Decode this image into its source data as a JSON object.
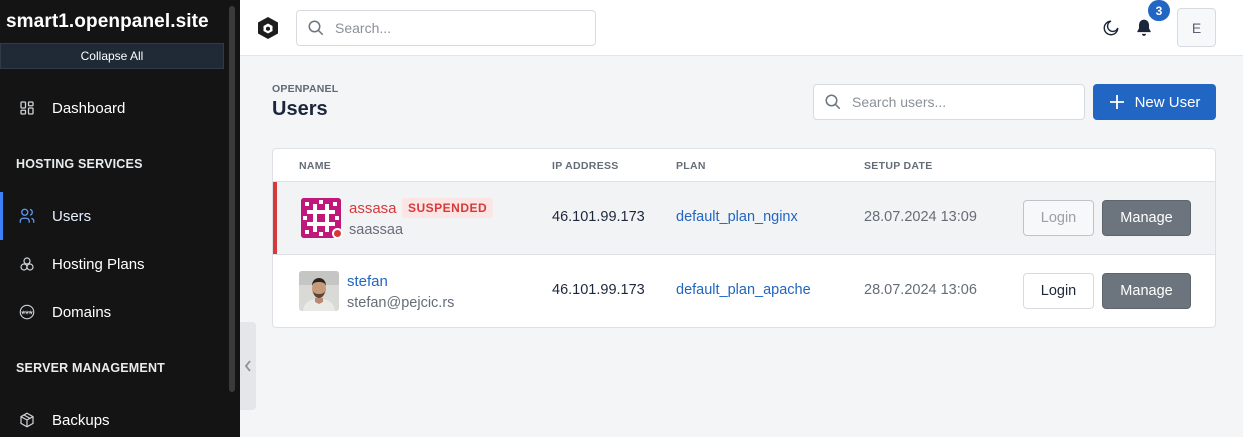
{
  "sidebar": {
    "site_title": "smart1.openpanel.site",
    "collapse_label": "Collapse All",
    "dashboard": "Dashboard",
    "section_hosting": "HOSTING SERVICES",
    "users": "Users",
    "hosting_plans": "Hosting Plans",
    "domains": "Domains",
    "section_server": "SERVER MANAGEMENT",
    "backups": "Backups"
  },
  "header": {
    "search_placeholder": "Search...",
    "notification_count": "3",
    "avatar_initial": "E"
  },
  "page": {
    "pretitle": "OPENPANEL",
    "title": "Users",
    "search_placeholder": "Search users...",
    "new_user_label": "New User"
  },
  "table": {
    "columns": [
      "NAME",
      "IP ADDRESS",
      "PLAN",
      "SETUP DATE"
    ],
    "rows": [
      {
        "username": "assasa",
        "status": "SUSPENDED",
        "email": "saassaa",
        "ip": "46.101.99.173",
        "plan": "default_plan_nginx",
        "setup_date": "28.07.2024 13:09",
        "login_label": "Login",
        "manage_label": "Manage"
      },
      {
        "username": "stefan",
        "status": "",
        "email": "stefan@pejcic.rs",
        "ip": "46.101.99.173",
        "plan": "default_plan_apache",
        "setup_date": "28.07.2024 13:06",
        "login_label": "Login",
        "manage_label": "Manage"
      }
    ]
  },
  "colors": {
    "primary": "#2166c2",
    "danger": "#d63939",
    "sidebar_bg": "#141414",
    "secondary_btn": "#6c757d"
  },
  "icons": {
    "dashboard": "dashboard-icon",
    "users": "users-icon",
    "hosting_plans": "stack-icon",
    "domains": "www-icon",
    "backups": "box-icon",
    "search": "search-icon",
    "theme": "moon-icon",
    "notifications": "bell-icon",
    "collapse": "chevron-left-icon",
    "add": "plus-icon"
  }
}
